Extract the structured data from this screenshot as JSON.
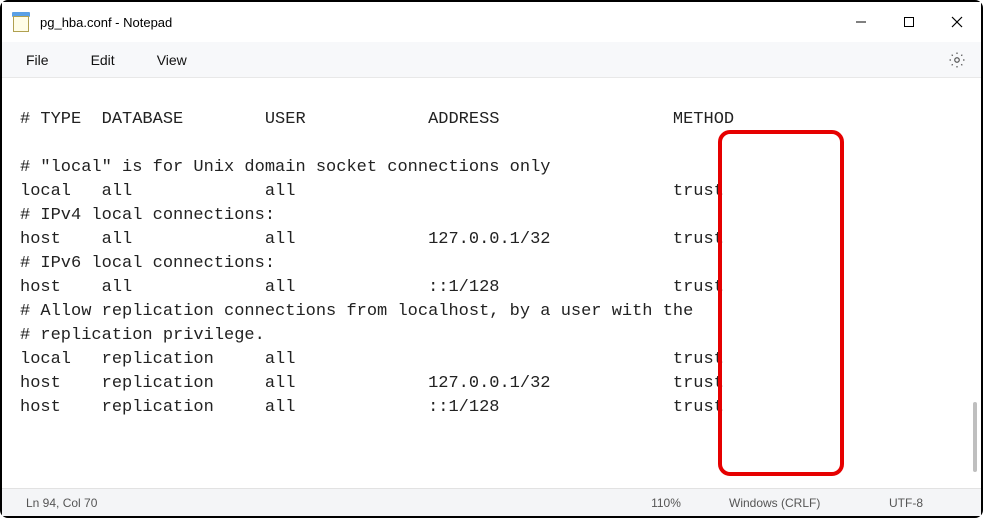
{
  "window": {
    "title": "pg_hba.conf - Notepad"
  },
  "menu": {
    "file": "File",
    "edit": "Edit",
    "view": "View"
  },
  "content_lines": [
    "# TYPE  DATABASE        USER            ADDRESS                 METHOD",
    "",
    "# \"local\" is for Unix domain socket connections only",
    "local   all             all                                     trust",
    "# IPv4 local connections:",
    "host    all             all             127.0.0.1/32            trust",
    "# IPv6 local connections:",
    "host    all             all             ::1/128                 trust",
    "# Allow replication connections from localhost, by a user with the",
    "# replication privilege.",
    "local   replication     all                                     trust",
    "host    replication     all             127.0.0.1/32            trust",
    "host    replication     all             ::1/128                 trust"
  ],
  "statusbar": {
    "position": "Ln 94, Col 70",
    "zoom": "110%",
    "line_ending": "Windows (CRLF)",
    "encoding": "UTF-8"
  }
}
